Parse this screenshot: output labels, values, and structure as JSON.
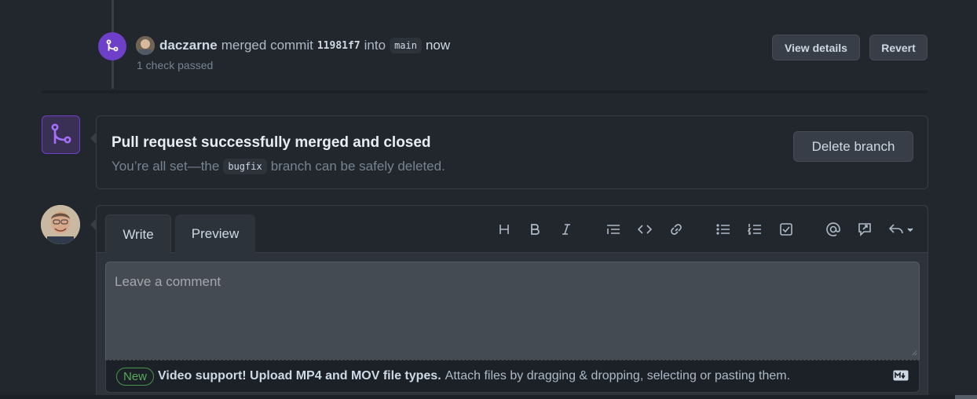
{
  "merge_event": {
    "author": "daczarne",
    "verb": "merged commit",
    "sha": "11981f7",
    "into": "into",
    "branch": "main",
    "time": "now",
    "check_status": "1 check passed",
    "view_details_label": "View details",
    "revert_label": "Revert"
  },
  "merged_box": {
    "title": "Pull request successfully merged and closed",
    "desc_prefix": "You’re all set—the",
    "branch": "bugfix",
    "desc_suffix": "branch can be safely deleted.",
    "delete_label": "Delete branch"
  },
  "comment": {
    "tabs": {
      "write": "Write",
      "preview": "Preview"
    },
    "placeholder": "Leave a comment",
    "toolbar_icons": [
      "heading-icon",
      "bold-icon",
      "italic-icon",
      "quote-icon",
      "code-icon",
      "link-icon",
      "bulleted-list-icon",
      "numbered-list-icon",
      "task-list-icon",
      "mention-icon",
      "reference-icon",
      "saved-replies-icon"
    ],
    "upload": {
      "badge": "New",
      "strong": "Video support! Upload MP4 and MOV file types.",
      "text": "Attach files by dragging & dropping, selecting or pasting them."
    }
  },
  "colors": {
    "background": "#22272e",
    "merged_purple": "#6e40c9",
    "new_green": "#57ab5a"
  }
}
